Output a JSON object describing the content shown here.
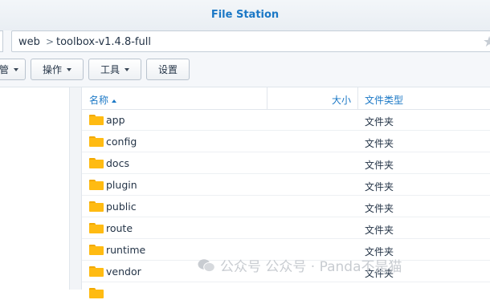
{
  "window": {
    "title": "File Station"
  },
  "address_bar": {
    "crumbs": [
      "web",
      "toolbox-v1.4.8-full"
    ],
    "separator": ">"
  },
  "toolbar": {
    "buttons": [
      {
        "label": "管",
        "has_caret": true
      },
      {
        "label": "操作",
        "has_caret": true
      },
      {
        "label": "工具",
        "has_caret": true
      },
      {
        "label": "设置",
        "has_caret": false
      }
    ]
  },
  "table": {
    "headers": {
      "name": "名称",
      "size": "大小",
      "type": "文件类型"
    },
    "sort": {
      "column": "name",
      "direction": "ascending"
    },
    "rows": [
      {
        "name": "app",
        "type": "文件夹"
      },
      {
        "name": "config",
        "type": "文件夹"
      },
      {
        "name": "docs",
        "type": "文件夹"
      },
      {
        "name": "plugin",
        "type": "文件夹"
      },
      {
        "name": "public",
        "type": "文件夹"
      },
      {
        "name": "route",
        "type": "文件夹"
      },
      {
        "name": "runtime",
        "type": "文件夹"
      },
      {
        "name": "vendor",
        "type": "文件夹"
      }
    ]
  },
  "watermark": {
    "text": "公众号 公众号 · Panda不是猫"
  },
  "colors": {
    "accent": "#1b78c6",
    "folder": "#ffbb12"
  }
}
